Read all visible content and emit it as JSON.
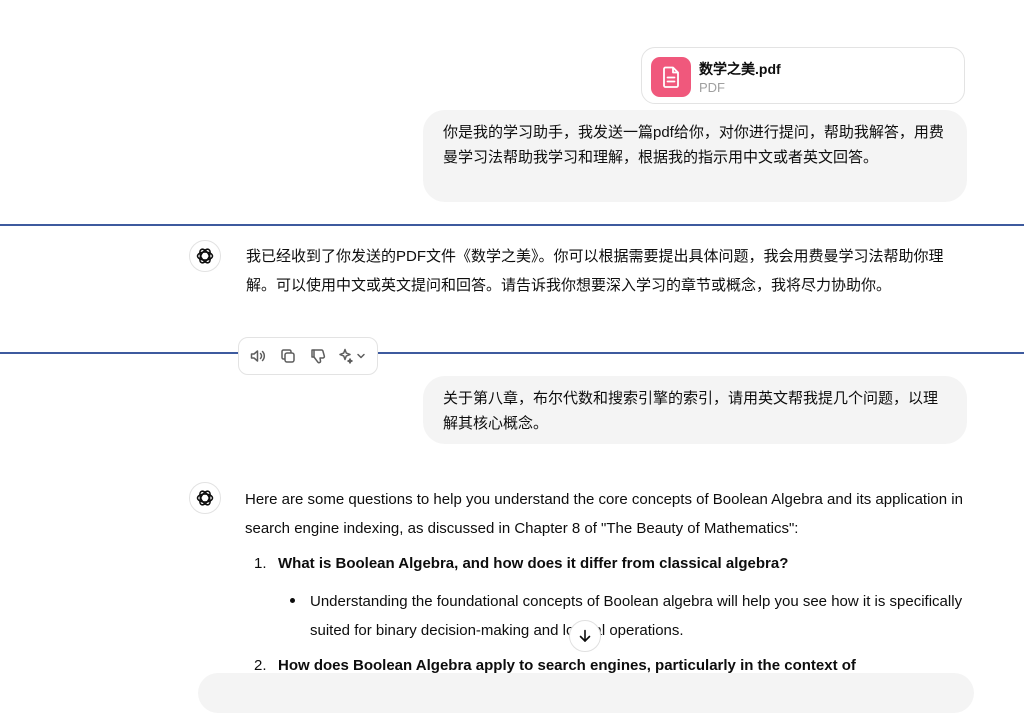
{
  "attachment": {
    "file_name": "数学之美.pdf",
    "file_type": "PDF",
    "icon": "document-icon",
    "color": "#f0587c"
  },
  "messages": {
    "user1": "你是我的学习助手，我发送一篇pdf给你，对你进行提问，帮助我解答，用费曼学习法帮助我学习和理解，根据我的指示用中文或者英文回答。",
    "assistant1": "我已经收到了你发送的PDF文件《数学之美》。你可以根据需要提出具体问题，我会用费曼学习法帮助你理解。可以使用中文或英文提问和回答。请告诉我你想要深入学习的章节或概念，我将尽力协助你。",
    "user2": "关于第八章，布尔代数和搜索引擎的索引，请用英文帮我提几个问题，以理解其核心概念。",
    "assistant2_intro": "Here are some questions to help you understand the core concepts of Boolean Algebra and its application in search engine indexing, as discussed in Chapter 8 of \"The Beauty of Mathematics\":",
    "list": [
      {
        "num": "1.",
        "title": "What is Boolean Algebra, and how does it differ from classical algebra?",
        "bullet": "Understanding the foundational concepts of Boolean algebra will help you see how it is specifically suited for binary decision-making and logical operations."
      },
      {
        "num": "2.",
        "title": "How does Boolean Algebra apply to search engines, particularly in the context of"
      }
    ]
  },
  "actions": [
    "read-aloud-icon",
    "copy-icon",
    "thumbs-down-icon",
    "regenerate-icon"
  ],
  "colors": {
    "separator": "#3d5a9e",
    "bubble": "#f4f4f4"
  }
}
